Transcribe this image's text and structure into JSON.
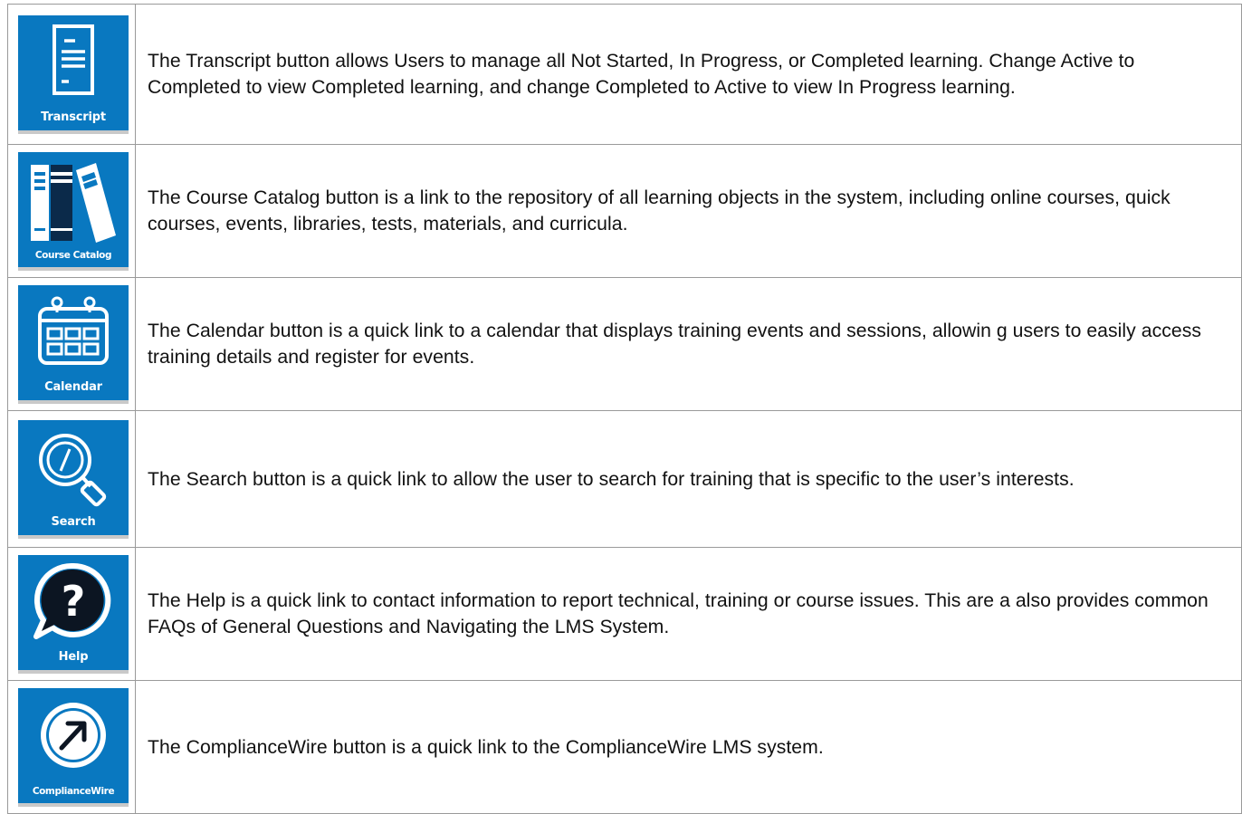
{
  "rows": [
    {
      "tile_label": "Transcript",
      "icon": "document-icon",
      "description": "The Transcript button allows Users to manage all Not Started, In Progress, or Completed learning. Change Active to Completed to view Completed learning, and change Completed to Active to view In Progress learning."
    },
    {
      "tile_label": "Course Catalog",
      "icon": "books-icon",
      "description": "The Course Catalog button is a link to the repository of all learning objects in the system, including online courses, quick courses, events,  libraries, tests, materials, and curricula."
    },
    {
      "tile_label": "Calendar",
      "icon": "calendar-icon",
      "description": "The Calendar button is a quick link to a calendar that displays training events and sessions, allowin g users to easily access training details  and register for events."
    },
    {
      "tile_label": "Search",
      "icon": "magnifier-icon",
      "description": "The Search button is a quick link to allow the user to search for training that is specific to the user’s interests."
    },
    {
      "tile_label": "Help",
      "icon": "question-bubble-icon",
      "description": "The Help is a quick link to contact information to report technical, training or course issues. This are a also provides common FAQs of  General Questions and Navigating the LMS System."
    },
    {
      "tile_label": "ComplianceWire",
      "icon": "arrow-circle-icon",
      "description": "The ComplianceWire button is a quick link to the ComplianceWire LMS system."
    }
  ],
  "colors": {
    "tile_blue": "#0978c0",
    "tile_shadow": "#c9c9c9",
    "border": "#9a9a9a",
    "text": "#111111"
  }
}
